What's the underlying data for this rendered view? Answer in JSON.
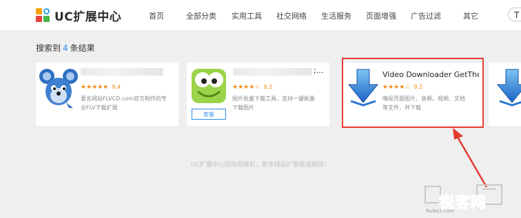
{
  "header": {
    "brand": "UC扩展中心",
    "nav": [
      "首页",
      "全部分类",
      "实用工具",
      "社交网络",
      "生活服务",
      "页面增强",
      "广告过滤",
      "其它"
    ],
    "search_partial": "T"
  },
  "results": {
    "prefix": "搜索到",
    "count": "4",
    "suffix": "条结果"
  },
  "cards": [
    {
      "icon": "mouse-mascot-icon",
      "rating_stars": "★★★★★",
      "score": "9.4",
      "description": [
        "著名网站FLVCD.com官方制作的专",
        "业FLV下载扩展"
      ]
    },
    {
      "icon": "frog-face-icon",
      "title_tail": ";...",
      "rating_stars": "★★★★☆",
      "score": "9.2",
      "description": [
        "图片批量下载工具，支持一键批量",
        "下载图片"
      ],
      "install_label": "安装"
    },
    {
      "icon": "download-arrow-icon",
      "title": "Video Downloader GetThe...",
      "rating_stars": "★★★★☆",
      "score": "9.2",
      "description": [
        "嗅探页面图片、音频、视频、文档",
        "等文件，并下载"
      ]
    },
    {
      "icon": "download-arrow-icon"
    }
  ],
  "footer_note": "UC扩展中心因你而精彩，更多精品扩展敬请期待！",
  "watermark": {
    "text": "锐客网",
    "sub": "Ruike1.com"
  },
  "colors": {
    "accent": "#2a8ae8",
    "star": "#f28a12",
    "annotation": "#e53a32"
  }
}
